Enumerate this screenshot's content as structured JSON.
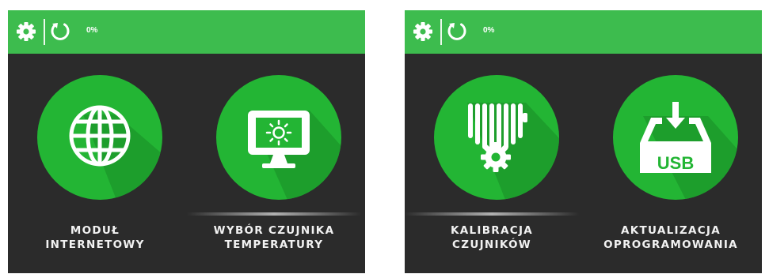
{
  "screens": [
    {
      "status": {
        "progress_text": "0%"
      },
      "tiles": [
        {
          "line1": "MODUŁ",
          "line2": "INTERNETOWY",
          "icon": "globe-icon",
          "selected": false
        },
        {
          "line1": "WYBÓR CZUJNIKA",
          "line2": "TEMPERATURY",
          "icon": "monitor-sun-icon",
          "selected": true
        }
      ]
    },
    {
      "status": {
        "progress_text": "0%"
      },
      "tiles": [
        {
          "line1": "KALIBRACJA",
          "line2": "CZUJNIKÓW",
          "icon": "radiator-gear-icon",
          "selected": true
        },
        {
          "line1": "AKTUALIZACJA",
          "line2": "OPROGRAMOWANIA",
          "icon": "usb-tray-icon",
          "icon_text": "USB",
          "selected": false
        }
      ]
    }
  ],
  "colors": {
    "topbar": "#3dbc4e",
    "background": "#2b2b2b",
    "circle": "#23b534",
    "text": "#f2f2f2"
  }
}
